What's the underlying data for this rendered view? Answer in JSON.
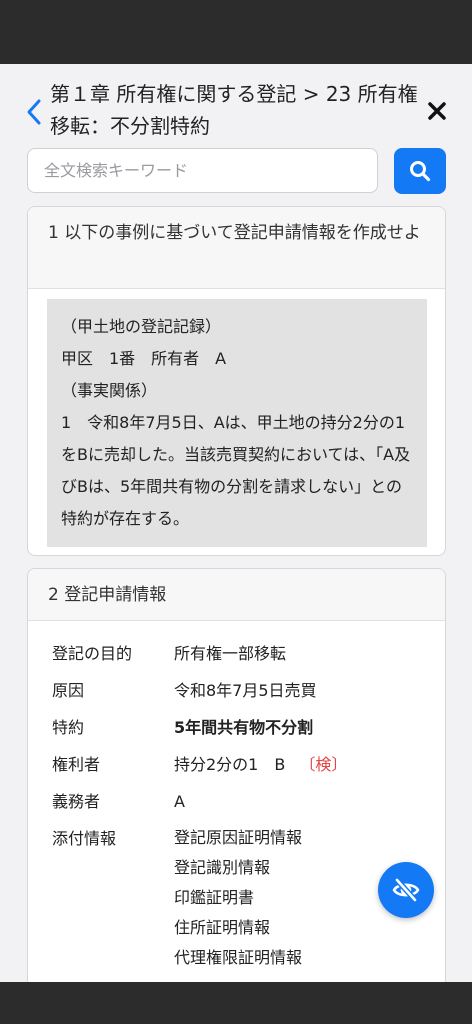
{
  "header": {
    "title": "第１章 所有権に関する登記 > 23 所有権移転：不分割特約"
  },
  "search": {
    "placeholder": "全文検索キーワード",
    "value": ""
  },
  "section1": {
    "heading": "1 以下の事例に基づいて登記申請情報を作成せよ",
    "facts": [
      "（甲土地の登記記録）",
      "甲区　1番　所有者　A",
      "（事実関係）",
      "1　令和8年7月5日、Aは、甲土地の持分2分の1をBに売却した。当該売買契約においては、「A及びBは、5年間共有物の分割を請求しない」との特約が存在する。"
    ]
  },
  "section2": {
    "heading": "2 登記申請情報",
    "rows": [
      {
        "label": "登記の目的",
        "value": "所有権一部移転"
      },
      {
        "label": "原因",
        "value": "令和8年7月5日売買"
      },
      {
        "label": "特約",
        "value": "5年間共有物不分割"
      },
      {
        "label": "権利者",
        "value": "持分2分の1　B",
        "badge": "〔検〕"
      },
      {
        "label": "義務者",
        "value": "A"
      },
      {
        "label": "添付情報",
        "values": [
          "登記原因証明情報",
          "登記識別情報",
          "印鑑証明書",
          "住所証明情報",
          "代理権限証明情報"
        ]
      }
    ]
  },
  "colors": {
    "accent": "#1479f5",
    "highlight": "#e24545",
    "bars": "#2c2c2c"
  }
}
